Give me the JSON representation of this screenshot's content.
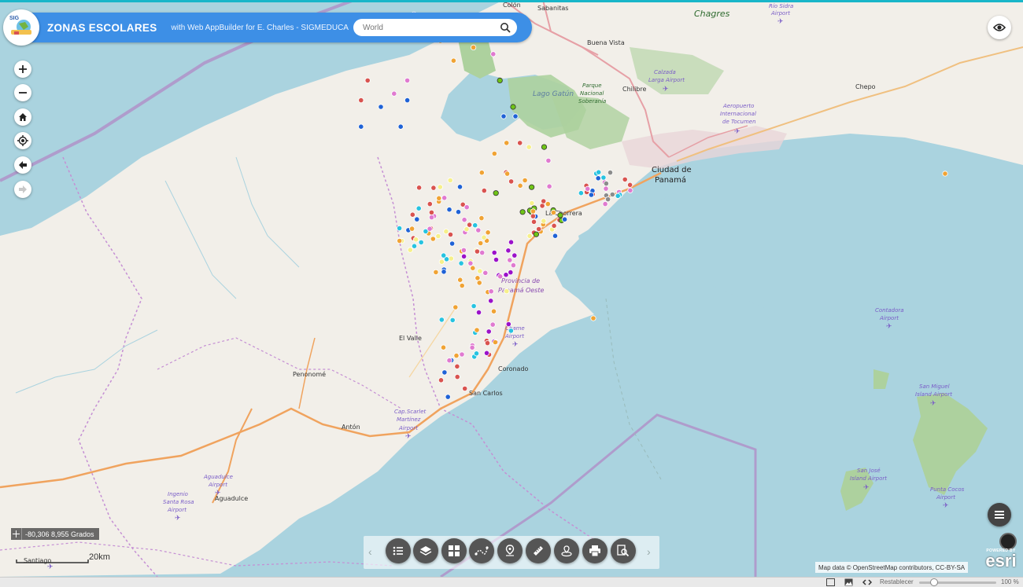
{
  "app": {
    "logo_text": "SIG",
    "title": "ZONAS ESCOLARES",
    "subtitle": "with Web AppBuilder for E. Charles - SIGMEDUCA",
    "search_placeholder": "World"
  },
  "map_labels": {
    "colon": "Colón",
    "sabanitas": "Sabanitas",
    "chagres": "Chagres",
    "rio_sidra": "Río Sidra",
    "airport": "Airport",
    "buena_vista": "Buena Vista",
    "parque": "Parque",
    "nacional": "Nacional",
    "soberania": "Soberanía",
    "calzada": "Calzada",
    "larga_airport": "Larga Airport",
    "chilibre": "Chilibre",
    "chepo": "Chepo",
    "lago_gatun": "Lago Gatún",
    "aeropuerto": "Aeropuerto",
    "internacional": "Internacional",
    "de_tocumen": "de Tocumen",
    "ciudad_de": "Ciudad de",
    "panama": "Panamá",
    "la_chorrera": "La Chorrera",
    "provincia_de": "Provincia de",
    "panama_oeste": "Panamá Oeste",
    "chame": "Chame",
    "el_valle": "El Valle",
    "coronado": "Coronado",
    "penonome": "Penonomé",
    "san_carlos": "San Carlos",
    "cap_scarlet": "Cap.Scarlet",
    "martinez": "Martínez",
    "anton": "Antón",
    "contadora": "Contadora",
    "san_miguel": "San Miguel",
    "island_airport": "Island Airport",
    "san_jose": "San José",
    "punta_cocos": "Punta Cocos",
    "aguadulce": "Aguadulce",
    "ingenio": "Ingenio",
    "santa_rosa": "Santa Rosa",
    "santiago": "Santiago"
  },
  "coords_readout": "-80,306 8,955 Grados",
  "scale_label": "20km",
  "attribution": "Map data © OpenStreetMap contributors, CC-BY-SA",
  "esri": {
    "powered_by": "POWERED BY",
    "logo": "esri"
  },
  "status": {
    "reset_label": "Restablecer",
    "zoom_percent": "100 %"
  },
  "colors": {
    "water": "#aad3df",
    "land": "#f2efe9",
    "forest": "#add19e",
    "header": "#3d8fe6",
    "boundary": "#b08fc7",
    "road": "#f0a35e",
    "point_blue": "#1f62d6",
    "point_red": "#d9534f",
    "point_pink": "#e07ad0",
    "point_orange": "#f0a334",
    "point_purple": "#9b12c9",
    "point_yellow": "#f6f08a",
    "point_cyan": "#27c3e0",
    "point_green": "#6fc416",
    "point_gray": "#8c8c8c"
  },
  "school_points": [
    {
      "c": "blue",
      "lon": -79.96,
      "lat": 9.05
    },
    {
      "c": "blue",
      "lon": -79.9,
      "lat": 9.05
    },
    {
      "c": "blue",
      "lon": -79.93,
      "lat": 9.08
    },
    {
      "c": "blue",
      "lon": -79.89,
      "lat": 9.09
    },
    {
      "c": "red",
      "lon": -79.96,
      "lat": 9.09
    },
    {
      "c": "red",
      "lon": -79.95,
      "lat": 9.12
    },
    {
      "c": "pink",
      "lon": -79.91,
      "lat": 9.1
    },
    {
      "c": "pink",
      "lon": -79.89,
      "lat": 9.12
    },
    {
      "c": "orange",
      "lon": -79.82,
      "lat": 9.15
    },
    {
      "c": "orange",
      "lon": -79.79,
      "lat": 9.17
    },
    {
      "c": "orange",
      "lon": -79.84,
      "lat": 9.18
    },
    {
      "c": "green",
      "lon": -79.75,
      "lat": 9.12
    },
    {
      "c": "green",
      "lon": -79.73,
      "lat": 9.08
    },
    {
      "c": "pink",
      "lon": -79.76,
      "lat": 9.16
    },
    {
      "c": "blue",
      "lon": -79.88,
      "lat": 9.22
    },
    {
      "c": "blue",
      "lon": -79.86,
      "lat": 9.25
    }
  ]
}
